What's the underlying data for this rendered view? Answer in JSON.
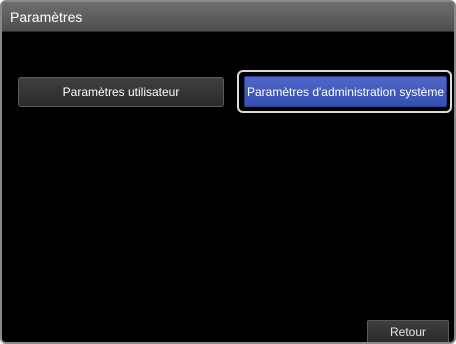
{
  "window": {
    "title": "Paramètres"
  },
  "buttons": {
    "user_settings": "Paramètres utilisateur",
    "admin_settings": "Paramètres d'administration système",
    "back": "Retour"
  },
  "colors": {
    "background": "#000000",
    "titlebar": "#5e5e5e",
    "selected_button": "#3f5bbd",
    "button": "#333333"
  }
}
